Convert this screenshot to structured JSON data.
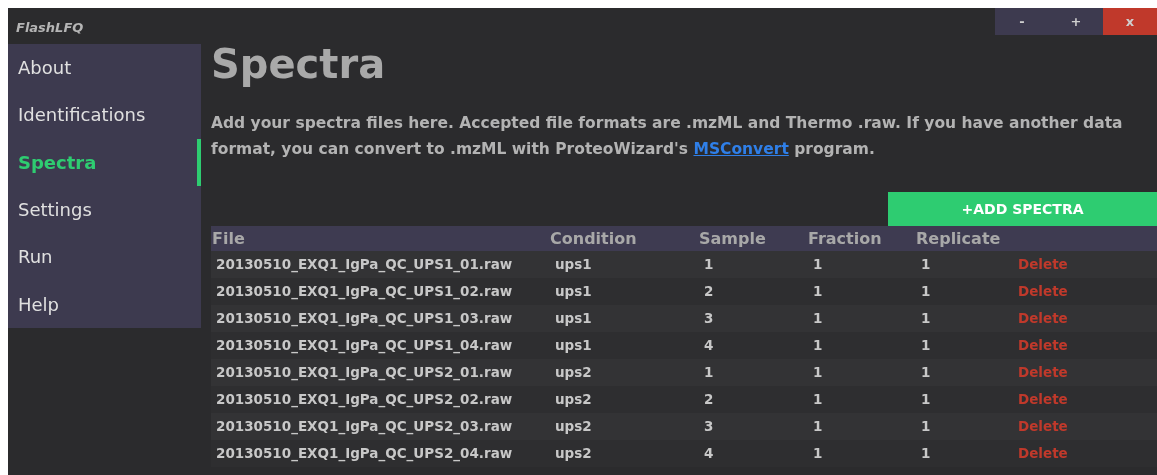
{
  "window": {
    "title": "FlashLFQ",
    "controls": [
      "-",
      "+",
      "x"
    ]
  },
  "sidebar": {
    "items": [
      {
        "label": "About",
        "selected": false
      },
      {
        "label": "Identifications",
        "selected": false
      },
      {
        "label": "Spectra",
        "selected": true
      },
      {
        "label": "Settings",
        "selected": false
      },
      {
        "label": "Run",
        "selected": false
      },
      {
        "label": "Help",
        "selected": false
      }
    ]
  },
  "page": {
    "title": "Spectra",
    "description_before": "Add your spectra files here. Accepted file formats are .mzML and Thermo .raw. If you have another data format, you can convert to .mzML with ProteoWizard's",
    "link": "MSConvert",
    "description_after": "program."
  },
  "add_button": "+ADD SPECTRA",
  "table": {
    "columns": [
      "File",
      "Condition",
      "Sample",
      "Fraction",
      "Replicate"
    ],
    "rows": [
      {
        "cells": [
          "20130510_EXQ1_IgPa_QC_UPS1_01.raw",
          "ups1",
          "1",
          "1",
          "1"
        ],
        "action": "Delete"
      },
      {
        "cells": [
          "20130510_EXQ1_IgPa_QC_UPS1_02.raw",
          "ups1",
          "2",
          "1",
          "1"
        ],
        "action": "Delete"
      },
      {
        "cells": [
          "20130510_EXQ1_IgPa_QC_UPS1_03.raw",
          "ups1",
          "3",
          "1",
          "1"
        ],
        "action": "Delete"
      },
      {
        "cells": [
          "20130510_EXQ1_IgPa_QC_UPS1_04.raw",
          "ups1",
          "4",
          "1",
          "1"
        ],
        "action": "Delete"
      },
      {
        "cells": [
          "20130510_EXQ1_IgPa_QC_UPS2_01.raw",
          "ups2",
          "1",
          "1",
          "1"
        ],
        "action": "Delete"
      },
      {
        "cells": [
          "20130510_EXQ1_IgPa_QC_UPS2_02.raw",
          "ups2",
          "2",
          "1",
          "1"
        ],
        "action": "Delete"
      },
      {
        "cells": [
          "20130510_EXQ1_IgPa_QC_UPS2_03.raw",
          "ups2",
          "3",
          "1",
          "1"
        ],
        "action": "Delete"
      },
      {
        "cells": [
          "20130510_EXQ1_IgPa_QC_UPS2_04.raw",
          "ups2",
          "4",
          "1",
          "1"
        ],
        "action": "Delete"
      }
    ]
  }
}
